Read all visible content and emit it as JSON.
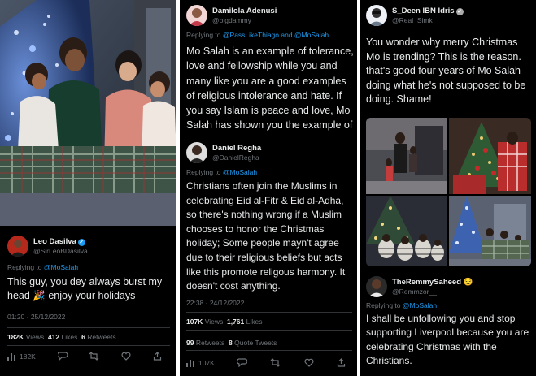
{
  "tweet_left": {
    "name": "Leo Dasilva",
    "handle": "@SirLeoBDasilva",
    "replying_label": "Replying to",
    "replying_to": "@MoSalah",
    "text_part1": "This guy, you dey always burst my head",
    "emoji": "🎉",
    "text_part2": "enjoy your holidays",
    "time": "01:20 · 25/12/2022",
    "views_count": "182K",
    "views_label": "Views",
    "likes_count": "412",
    "likes_label": "Likes",
    "retweets_count": "6",
    "retweets_label": "Retweets",
    "action_views": "182K"
  },
  "tweet_mid_top": {
    "name": "Damilola Adenusi",
    "handle": "@bigdammy_",
    "replying_label": "Replying to",
    "replying_to": "@PassLikeThiago and @MoSalah",
    "text": "Mo Salah is an example of tolerance, love and fellowship while you and many like you are a good examples of religious intolerance and hate. If you say Islam is peace and love, Mo Salah has shown you the example of that. You need to"
  },
  "tweet_mid_bottom": {
    "name": "Daniel Regha",
    "handle": "@DanielRegha",
    "replying_label": "Replying to",
    "replying_to": "@MoSalah",
    "text": "Christians often join the Muslims in celebrating Eid al-Fitr & Eid al-Adha, so there's nothing wrong if a Muslim chooses to honor the Christmas holiday; Some people mayn't agree due to their religious beliefs but acts like this promote religous harmony. It doesn't cost anything.",
    "time": "22:38 · 24/12/2022",
    "views_count": "107K",
    "views_label": "Views",
    "likes_count": "1,761",
    "likes_label": "Likes",
    "retweets_count": "99",
    "retweets_label": "Retweets",
    "quotes_count": "8",
    "quotes_label": "Quote Tweets",
    "action_views": "107K"
  },
  "tweet_right_top": {
    "name": "S_Deen IBN Idris",
    "handle": "@Real_Simk",
    "text": "You wonder why merry Christmas Mo is trending? This is the reason. that's good four years of Mo Salah doing what he's not supposed to be doing. Shame!"
  },
  "tweet_right_bottom": {
    "name": "TheRemmySaheed",
    "emoji": "😏",
    "handle": "@Remmzor__",
    "replying_label": "Replying to",
    "replying_to": "@MoSalah",
    "text": "I shall be unfollowing you and stop supporting Liverpool because you are celebrating Christmas with the Christians."
  },
  "colors": {
    "background": "#000000",
    "text": "#e7e9ea",
    "muted": "#71767b",
    "link": "#1d9bf0",
    "divider": "#2f3336"
  },
  "icons": [
    "verified-badge-icon",
    "views-icon",
    "reply-icon",
    "retweet-icon",
    "like-icon",
    "share-icon"
  ]
}
